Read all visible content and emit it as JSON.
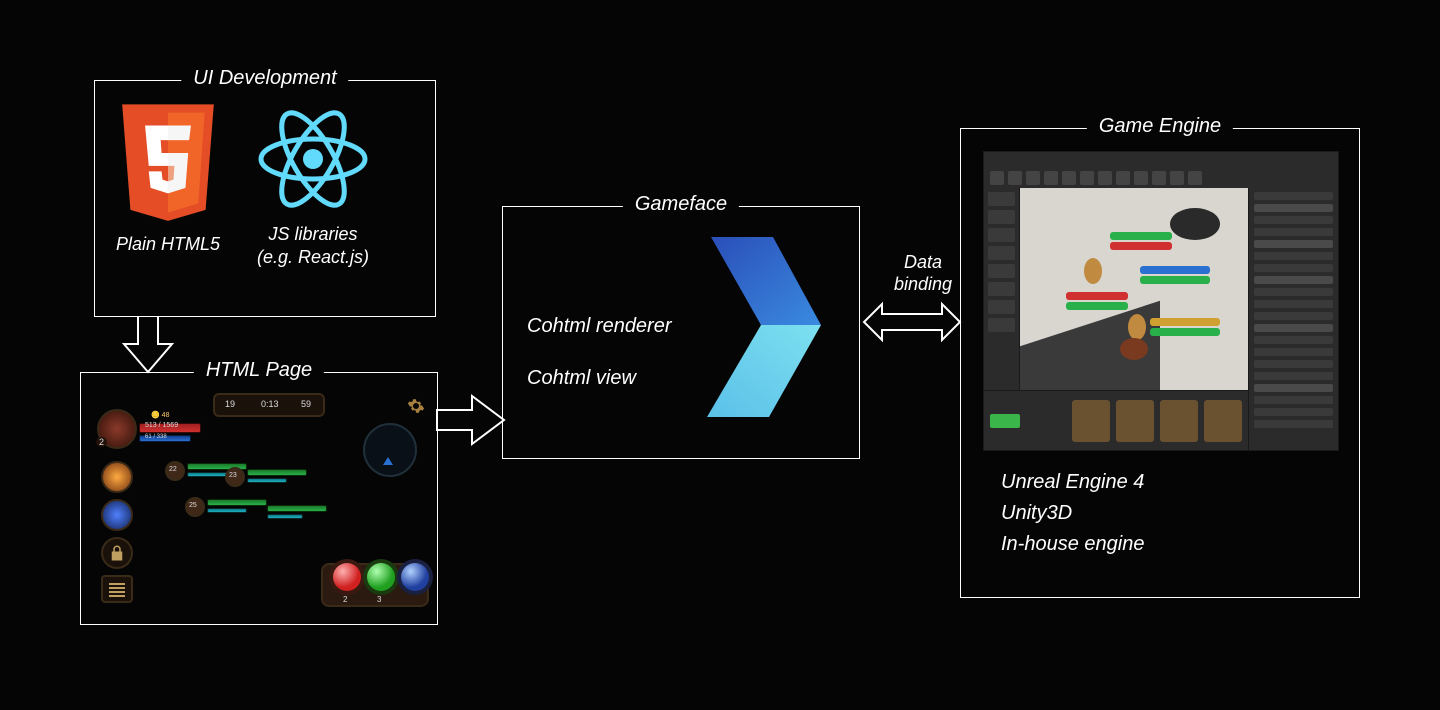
{
  "boxes": {
    "ui_dev": {
      "title": "UI Development",
      "html5_caption": "Plain HTML5",
      "js_caption_l1": "JS libraries",
      "js_caption_l2": "(e.g. React.js)"
    },
    "html_page": {
      "title": "HTML Page",
      "hud_values": {
        "top_score_left": "19",
        "top_timer": "0:13",
        "top_score_right": "59",
        "hp_text": "513 / 1569",
        "armor_text": "61 / 338",
        "coins": "48",
        "level_badge": "2",
        "unit1_lvl": "22",
        "unit2_lvl": "23",
        "unit3_lvl": "25",
        "pot1_count": "2",
        "pot2_count": "3"
      }
    },
    "gameface": {
      "title": "Gameface",
      "line1": "Cohtml renderer",
      "line2": "Cohtml view"
    },
    "game_engine": {
      "title": "Game Engine",
      "engines": [
        "Unreal Engine 4",
        "Unity3D",
        "In-house engine"
      ]
    }
  },
  "arrows": {
    "data_binding_l1": "Data",
    "data_binding_l2": "binding"
  }
}
